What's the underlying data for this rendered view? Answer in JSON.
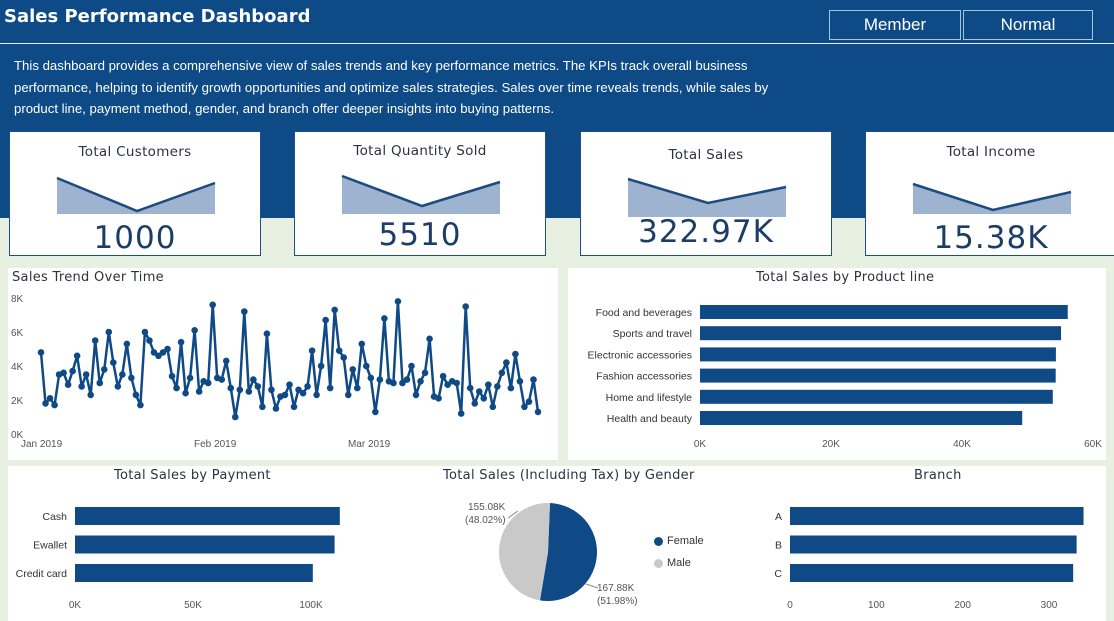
{
  "header": {
    "title": "Sales Performance Dashboard",
    "nav_buttons": [
      "Member",
      "Normal"
    ],
    "description": "This dashboard provides a comprehensive view of sales trends and key performance metrics. The KPIs track overall business performance, helping to identify growth opportunities and optimize sales strategies. Sales over time reveals trends, while sales by product line, payment method, gender, and branch offer deeper insights into buying patterns."
  },
  "kpis": [
    {
      "label": "Total Customers",
      "value": "1000"
    },
    {
      "label": "Total Quantity Sold",
      "value": "5510"
    },
    {
      "label": "Total Sales",
      "value": "322.97K"
    },
    {
      "label": "Total Income",
      "value": "15.38K"
    }
  ],
  "colors": {
    "header_bg": "#0d4a86",
    "bar": "#0f4a86",
    "sparkline_fill": "#9eb3cf",
    "female": "#0f4a86",
    "male": "#c9c9c9",
    "page_bg": "#e8f0e2"
  },
  "chart_data": [
    {
      "id": "trend",
      "type": "line",
      "title": "Sales Trend Over Time",
      "x_labels": [
        "Jan 2019",
        "Feb 2019",
        "Mar 2019"
      ],
      "y_ticks": [
        "0K",
        "2K",
        "4K",
        "6K",
        "8K"
      ],
      "ylim": [
        0,
        8000
      ],
      "values": [
        4800,
        1800,
        2100,
        1700,
        3500,
        3600,
        2900,
        3700,
        4600,
        2800,
        3500,
        2300,
        5500,
        3000,
        3800,
        6000,
        4200,
        2800,
        3500,
        5300,
        3300,
        2300,
        1700,
        6000,
        5500,
        4800,
        4600,
        4800,
        5000,
        3400,
        2700,
        5400,
        2400,
        3300,
        6100,
        2500,
        3100,
        3000,
        7600,
        3300,
        3200,
        4300,
        2700,
        1000,
        2600,
        7200,
        2500,
        3200,
        2800,
        1600,
        5900,
        2600,
        1500,
        2200,
        2300,
        2900,
        1600,
        2600,
        2400,
        2800,
        4900,
        2300,
        4000,
        6700,
        2700,
        7300,
        4900,
        4500,
        2300,
        3800,
        2700,
        5300,
        4000,
        3300,
        1300,
        3200,
        6800,
        3100,
        3000,
        7800,
        3000,
        3200,
        4000,
        2300,
        3100,
        3600,
        5600,
        2200,
        2100,
        3400,
        2900,
        3100,
        3000,
        1200,
        7500,
        2700,
        1800,
        2500,
        2100,
        2900,
        1600,
        2800,
        3600,
        4200,
        2700,
        4700,
        3100,
        1600,
        1900,
        3200,
        1300
      ]
    },
    {
      "id": "product_line",
      "type": "bar",
      "title": "Total Sales by Product line",
      "categories": [
        "Food and beverages",
        "Sports and travel",
        "Electronic accessories",
        "Fashion accessories",
        "Home and lifestyle",
        "Health and beauty"
      ],
      "values": [
        56144,
        55123,
        54338,
        54306,
        53862,
        49194
      ],
      "x_ticks": [
        "0K",
        "20K",
        "40K",
        "60K"
      ],
      "xlim": [
        0,
        60000
      ]
    },
    {
      "id": "payment",
      "type": "bar",
      "title": "Total Sales by Payment",
      "categories": [
        "Cash",
        "Ewallet",
        "Credit card"
      ],
      "values": [
        112207,
        109993,
        100767
      ],
      "x_ticks": [
        "0K",
        "50K",
        "100K"
      ],
      "xlim": [
        0,
        100000
      ]
    },
    {
      "id": "gender",
      "type": "pie",
      "title": "Total Sales (Including Tax) by Gender",
      "slices": [
        {
          "name": "Female",
          "value": 167.88,
          "label": "167.88K",
          "pct": "(51.98%)"
        },
        {
          "name": "Male",
          "value": 155.08,
          "label": "155.08K",
          "pct": "(48.02%)"
        }
      ]
    },
    {
      "id": "branch",
      "type": "bar",
      "title": "Branch",
      "categories": [
        "A",
        "B",
        "C"
      ],
      "values": [
        340,
        332,
        328
      ],
      "x_ticks": [
        "0",
        "100",
        "200",
        "300"
      ],
      "xlim": [
        0,
        300
      ]
    }
  ]
}
